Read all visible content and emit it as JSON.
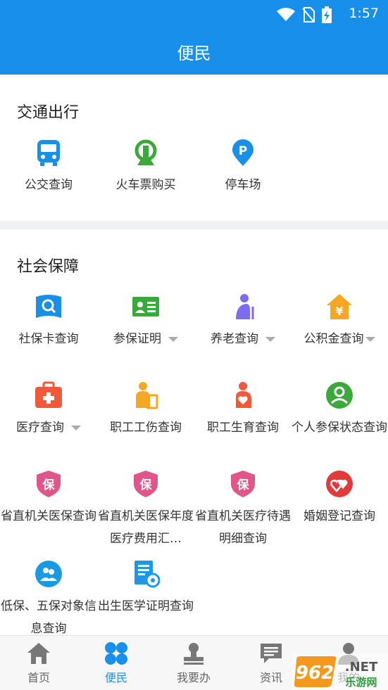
{
  "status_bar": {
    "time": "1:57",
    "icons": [
      "wifi-icon",
      "no-sim-icon",
      "battery-charging-icon"
    ]
  },
  "header": {
    "title": "便民"
  },
  "transport": {
    "title": "交通出行",
    "items": [
      {
        "label": "公交查询",
        "icon": "bus-icon",
        "color": "#1a8fe6"
      },
      {
        "label": "火车票购买",
        "icon": "train-icon",
        "color": "#3aa83a"
      },
      {
        "label": "停车场",
        "icon": "parking-pin-icon",
        "color": "#1a8fe6"
      }
    ]
  },
  "social": {
    "title": "社会保障",
    "items": [
      {
        "label": "社保卡查询",
        "icon": "social-card-search-icon",
        "color": "#1a8fe6"
      },
      {
        "label": "参保证明",
        "icon": "id-card-icon",
        "color": "#3aa83a",
        "dropdown": true
      },
      {
        "label": "养老查询",
        "icon": "elderly-icon",
        "color": "#7b6cf0",
        "dropdown": true
      },
      {
        "label": "公积金查询",
        "icon": "housing-fund-icon",
        "color": "#f5a623",
        "dropdown": true
      },
      {
        "label": "医疗查询",
        "icon": "medical-kit-icon",
        "color": "#f05a3a",
        "dropdown": true
      },
      {
        "label": "职工工伤查询",
        "icon": "work-injury-icon",
        "color": "#f5a623"
      },
      {
        "label": "职工生育查询",
        "icon": "maternity-icon",
        "color": "#f05a3a"
      },
      {
        "label": "个人参保状态查询",
        "icon": "insurance-status-icon",
        "color": "#3aa83a"
      },
      {
        "label": "省直机关医保查询",
        "icon": "bao-shield-icon",
        "color": "#e0558a"
      },
      {
        "label": "省直机关医保年度医疗费用汇…",
        "icon": "bao-shield-icon",
        "color": "#e0558a"
      },
      {
        "label": "省直机关医疗待遇明细查询",
        "icon": "bao-shield-icon",
        "color": "#e0558a"
      },
      {
        "label": "婚姻登记查询",
        "icon": "marriage-hearts-icon",
        "color": "#e03a3a"
      },
      {
        "label": "低保、五保对象信息查询",
        "icon": "welfare-people-icon",
        "color": "#1a9ae6"
      },
      {
        "label": "出生医学证明查询",
        "icon": "birth-certificate-icon",
        "color": "#1a9ae6"
      }
    ]
  },
  "tabbar": {
    "items": [
      {
        "label": "首页",
        "icon": "home-icon",
        "active": false
      },
      {
        "label": "便民",
        "icon": "convenience-grid-icon",
        "active": true
      },
      {
        "label": "我要办",
        "icon": "stamp-icon",
        "active": false
      },
      {
        "label": "资讯",
        "icon": "news-chat-icon",
        "active": false
      },
      {
        "label": "我的",
        "icon": "user-icon",
        "active": false
      }
    ]
  },
  "watermark": {
    "text_top": "962.NET",
    "text_bottom": "乐游网"
  },
  "colors": {
    "primary": "#1690ea",
    "tab_active": "#1690ea",
    "tab_inactive": "#666666",
    "band": "#eef0f3"
  }
}
